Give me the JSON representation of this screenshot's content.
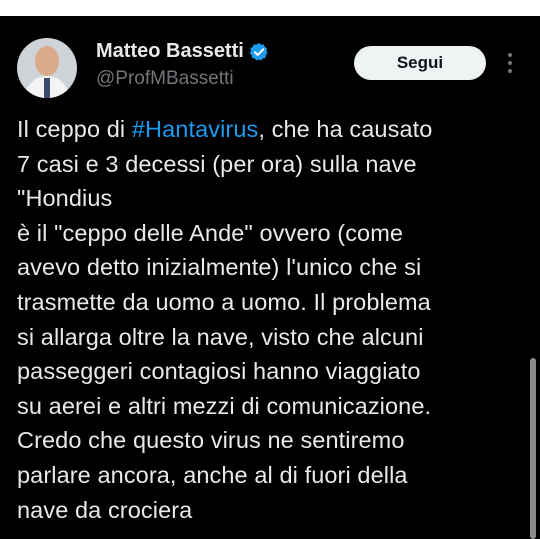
{
  "tweet": {
    "display_name": "Matteo Bassetti",
    "handle": "@ProfMBassetti",
    "follow_label": "Segui",
    "text_before_hashtag": "Il ceppo di ",
    "hashtag": "#Hantavirus",
    "text_after_hashtag": ", che ha causato\n7 casi e 3 decessi (per ora) sulla nave\n\"Hondius\nè il \"ceppo delle Ande\" ovvero (come\navevo detto inizialmente) l'unico che si\ntrasmette da uomo a uomo. Il problema\nsi allarga oltre la nave, visto che alcuni\npasseggeri contagiosi hanno viaggiato\nsu aerei e altri mezzi di comunicazione.\nCredo che questo virus ne sentiremo\nparlare ancora, anche al di fuori della\nnave da crociera"
  },
  "icons": {
    "verified": "verified-badge-icon",
    "more": "more-vertical-icon",
    "avatar": "avatar"
  },
  "colors": {
    "background": "#000000",
    "text": "#e7e9ea",
    "secondary_text": "#71767b",
    "hashtag": "#1d9bf0",
    "verified": "#1d9bf0",
    "follow_button_bg": "#eff3f4"
  }
}
